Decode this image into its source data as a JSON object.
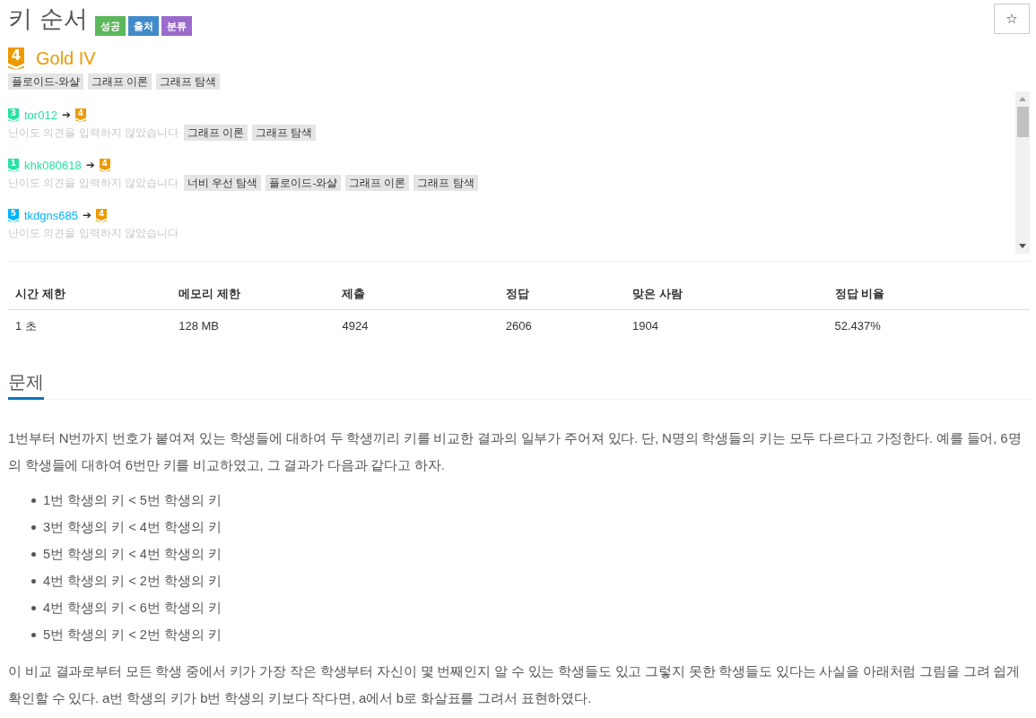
{
  "problem": {
    "title": "키 순서",
    "labels": [
      {
        "text": "성공",
        "color": "#5cb85c"
      },
      {
        "text": "출처",
        "color": "#428bca"
      },
      {
        "text": "분류",
        "color": "#9b6bcc"
      }
    ],
    "star_button": "☆"
  },
  "tier": {
    "badge": "4",
    "color": "#ec9a00",
    "name": "Gold IV"
  },
  "tags": [
    "플로이드-와샬",
    "그래프 이론",
    "그래프 탐색"
  ],
  "opinions": [
    {
      "from": {
        "badge": "3",
        "color": "#27e2a4"
      },
      "user": "tor012",
      "arrow": "➔",
      "to": {
        "badge": "4",
        "color": "#ec9a00"
      },
      "comment": "난이도 의견을 입력하지 않았습니다",
      "tags": [
        "그래프 이론",
        "그래프 탐색"
      ]
    },
    {
      "from": {
        "badge": "1",
        "color": "#27e2a4"
      },
      "user": "khk080618",
      "arrow": "➔",
      "to": {
        "badge": "4",
        "color": "#ec9a00"
      },
      "comment": "난이도 의견을 입력하지 않았습니다",
      "tags": [
        "너비 우선 탐색",
        "플로이드-와샬",
        "그래프 이론",
        "그래프 탐색"
      ]
    },
    {
      "from": {
        "badge": "5",
        "color": "#00b4fc"
      },
      "user": "tkdgns685",
      "arrow": "➔",
      "to": {
        "badge": "4",
        "color": "#ec9a00"
      },
      "comment": "난이도 의견을 입력하지 않았습니다"
    }
  ],
  "stats_table": {
    "columns": [
      "시간 제한",
      "메모리 제한",
      "제출",
      "정답",
      "맞은 사람",
      "정답 비율"
    ],
    "rows": [
      [
        "1 초",
        "128 MB",
        "4924",
        "2606",
        "1904",
        "52.437%"
      ]
    ]
  },
  "problem_section": {
    "heading": "문제",
    "body": [
      {
        "kind": "paragraph",
        "text": "1번부터 N번까지 번호가 붙여져 있는 학생들에 대하여 두 학생끼리 키를 비교한 결과의 일부가 주어져 있다. 단, N명의 학생들의 키는 모두 다르다고 가정한다. 예를 들어, 6명의 학생들에 대하여 6번만 키를 비교하였고, 그 결과가 다음과 같다고 하자."
      },
      {
        "kind": "list",
        "items": [
          "1번 학생의 키 < 5번 학생의 키",
          "3번 학생의 키 < 4번 학생의 키",
          "5번 학생의 키 < 4번 학생의 키",
          "4번 학생의 키 < 2번 학생의 키",
          "4번 학생의 키 < 6번 학생의 키",
          "5번 학생의 키 < 2번 학생의 키"
        ]
      },
      {
        "kind": "paragraph",
        "text": "이 비교 결과로부터 모든 학생 중에서 키가 가장 작은 학생부터 자신이 몇 번째인지 알 수 있는 학생들도 있고 그렇지 못한 학생들도 있다는 사실을 아래처럼 그림을 그려 쉽게 확인할 수 있다. a번 학생의 키가 b번 학생의 키보다 작다면, a에서 b로 화살표를 그려서 표현하였다."
      }
    ]
  }
}
